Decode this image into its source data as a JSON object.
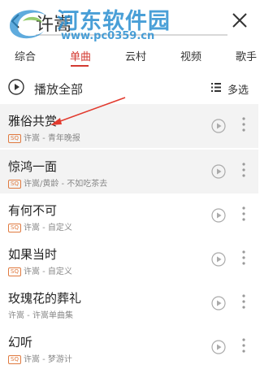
{
  "search": {
    "query": "许嵩"
  },
  "watermark": {
    "title": "河东软件园",
    "url": "www.pc0359.cn"
  },
  "tabs": [
    {
      "label": "综合",
      "active": false
    },
    {
      "label": "单曲",
      "active": true
    },
    {
      "label": "云村",
      "active": false
    },
    {
      "label": "视频",
      "active": false
    },
    {
      "label": "歌手",
      "active": false
    }
  ],
  "toolbar": {
    "play_all": "播放全部",
    "multi_select": "多选"
  },
  "songs": [
    {
      "title": "雅俗共赏",
      "sq": "SQ",
      "meta": "许嵩 - 青年晚报"
    },
    {
      "title": "惊鸿一面",
      "sq": "SQ",
      "meta": "许嵩/黄龄 - 不如吃茶去"
    },
    {
      "title": "有何不可",
      "sq": "SQ",
      "meta": "许嵩 - 自定义"
    },
    {
      "title": "如果当时",
      "sq": "SQ",
      "meta": "许嵩 - 自定义"
    },
    {
      "title": "玫瑰花的葬礼",
      "sq": "",
      "meta": "许嵩 - 许嵩单曲集"
    },
    {
      "title": "幻听",
      "sq": "SQ",
      "meta": "许嵩 - 梦游计"
    }
  ],
  "colors": {
    "accent": "#d33a31",
    "watermark": "#2a8fd1",
    "annotation_arrow": "#e23a2e"
  }
}
